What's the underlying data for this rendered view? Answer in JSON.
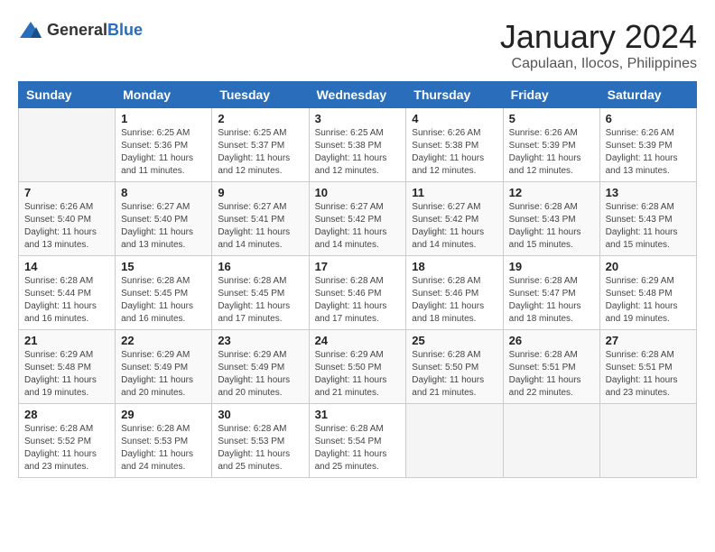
{
  "logo": {
    "general": "General",
    "blue": "Blue"
  },
  "header": {
    "title": "January 2024",
    "subtitle": "Capulaan, Ilocos, Philippines"
  },
  "columns": [
    "Sunday",
    "Monday",
    "Tuesday",
    "Wednesday",
    "Thursday",
    "Friday",
    "Saturday"
  ],
  "weeks": [
    [
      {
        "day": "",
        "info": ""
      },
      {
        "day": "1",
        "info": "Sunrise: 6:25 AM\nSunset: 5:36 PM\nDaylight: 11 hours and 11 minutes."
      },
      {
        "day": "2",
        "info": "Sunrise: 6:25 AM\nSunset: 5:37 PM\nDaylight: 11 hours and 12 minutes."
      },
      {
        "day": "3",
        "info": "Sunrise: 6:25 AM\nSunset: 5:38 PM\nDaylight: 11 hours and 12 minutes."
      },
      {
        "day": "4",
        "info": "Sunrise: 6:26 AM\nSunset: 5:38 PM\nDaylight: 11 hours and 12 minutes."
      },
      {
        "day": "5",
        "info": "Sunrise: 6:26 AM\nSunset: 5:39 PM\nDaylight: 11 hours and 12 minutes."
      },
      {
        "day": "6",
        "info": "Sunrise: 6:26 AM\nSunset: 5:39 PM\nDaylight: 11 hours and 13 minutes."
      }
    ],
    [
      {
        "day": "7",
        "info": "Sunrise: 6:26 AM\nSunset: 5:40 PM\nDaylight: 11 hours and 13 minutes."
      },
      {
        "day": "8",
        "info": "Sunrise: 6:27 AM\nSunset: 5:40 PM\nDaylight: 11 hours and 13 minutes."
      },
      {
        "day": "9",
        "info": "Sunrise: 6:27 AM\nSunset: 5:41 PM\nDaylight: 11 hours and 14 minutes."
      },
      {
        "day": "10",
        "info": "Sunrise: 6:27 AM\nSunset: 5:42 PM\nDaylight: 11 hours and 14 minutes."
      },
      {
        "day": "11",
        "info": "Sunrise: 6:27 AM\nSunset: 5:42 PM\nDaylight: 11 hours and 14 minutes."
      },
      {
        "day": "12",
        "info": "Sunrise: 6:28 AM\nSunset: 5:43 PM\nDaylight: 11 hours and 15 minutes."
      },
      {
        "day": "13",
        "info": "Sunrise: 6:28 AM\nSunset: 5:43 PM\nDaylight: 11 hours and 15 minutes."
      }
    ],
    [
      {
        "day": "14",
        "info": "Sunrise: 6:28 AM\nSunset: 5:44 PM\nDaylight: 11 hours and 16 minutes."
      },
      {
        "day": "15",
        "info": "Sunrise: 6:28 AM\nSunset: 5:45 PM\nDaylight: 11 hours and 16 minutes."
      },
      {
        "day": "16",
        "info": "Sunrise: 6:28 AM\nSunset: 5:45 PM\nDaylight: 11 hours and 17 minutes."
      },
      {
        "day": "17",
        "info": "Sunrise: 6:28 AM\nSunset: 5:46 PM\nDaylight: 11 hours and 17 minutes."
      },
      {
        "day": "18",
        "info": "Sunrise: 6:28 AM\nSunset: 5:46 PM\nDaylight: 11 hours and 18 minutes."
      },
      {
        "day": "19",
        "info": "Sunrise: 6:28 AM\nSunset: 5:47 PM\nDaylight: 11 hours and 18 minutes."
      },
      {
        "day": "20",
        "info": "Sunrise: 6:29 AM\nSunset: 5:48 PM\nDaylight: 11 hours and 19 minutes."
      }
    ],
    [
      {
        "day": "21",
        "info": "Sunrise: 6:29 AM\nSunset: 5:48 PM\nDaylight: 11 hours and 19 minutes."
      },
      {
        "day": "22",
        "info": "Sunrise: 6:29 AM\nSunset: 5:49 PM\nDaylight: 11 hours and 20 minutes."
      },
      {
        "day": "23",
        "info": "Sunrise: 6:29 AM\nSunset: 5:49 PM\nDaylight: 11 hours and 20 minutes."
      },
      {
        "day": "24",
        "info": "Sunrise: 6:29 AM\nSunset: 5:50 PM\nDaylight: 11 hours and 21 minutes."
      },
      {
        "day": "25",
        "info": "Sunrise: 6:28 AM\nSunset: 5:50 PM\nDaylight: 11 hours and 21 minutes."
      },
      {
        "day": "26",
        "info": "Sunrise: 6:28 AM\nSunset: 5:51 PM\nDaylight: 11 hours and 22 minutes."
      },
      {
        "day": "27",
        "info": "Sunrise: 6:28 AM\nSunset: 5:51 PM\nDaylight: 11 hours and 23 minutes."
      }
    ],
    [
      {
        "day": "28",
        "info": "Sunrise: 6:28 AM\nSunset: 5:52 PM\nDaylight: 11 hours and 23 minutes."
      },
      {
        "day": "29",
        "info": "Sunrise: 6:28 AM\nSunset: 5:53 PM\nDaylight: 11 hours and 24 minutes."
      },
      {
        "day": "30",
        "info": "Sunrise: 6:28 AM\nSunset: 5:53 PM\nDaylight: 11 hours and 25 minutes."
      },
      {
        "day": "31",
        "info": "Sunrise: 6:28 AM\nSunset: 5:54 PM\nDaylight: 11 hours and 25 minutes."
      },
      {
        "day": "",
        "info": ""
      },
      {
        "day": "",
        "info": ""
      },
      {
        "day": "",
        "info": ""
      }
    ]
  ]
}
